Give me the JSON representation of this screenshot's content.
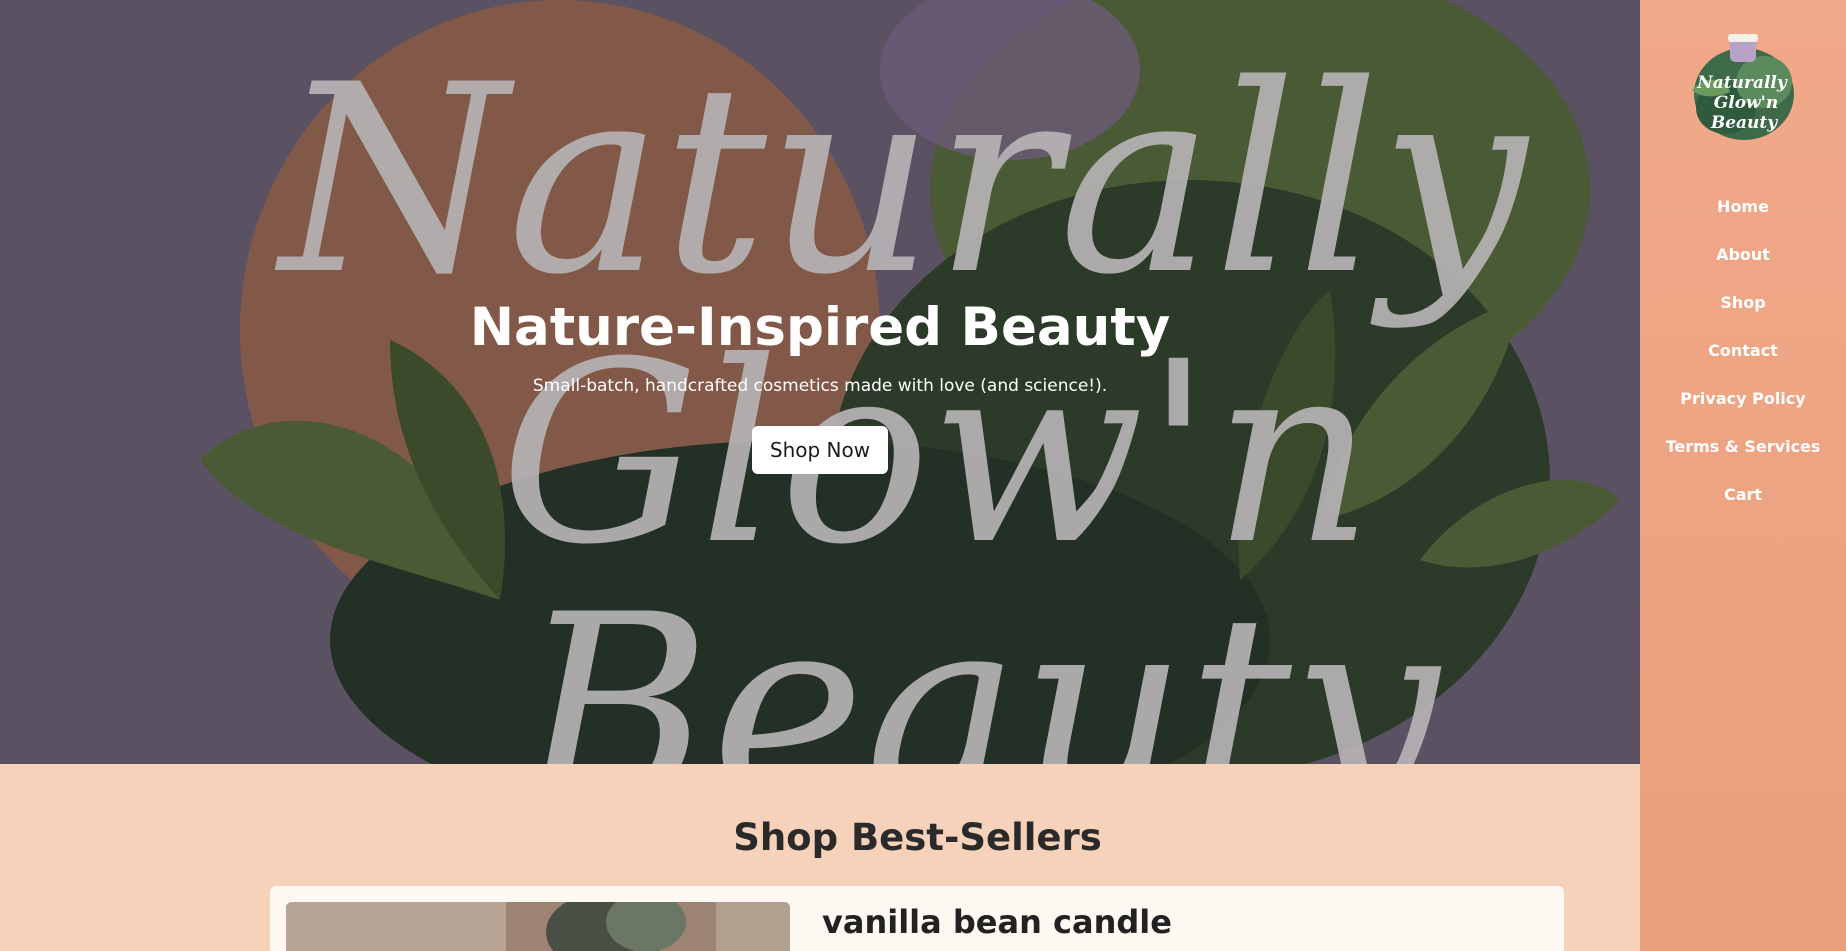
{
  "hero": {
    "title": "Nature-Inspired Beauty",
    "subtitle": "Small-batch, handcrafted cosmetics made with love (and science!).",
    "cta_label": "Shop Now",
    "background_text": [
      "Naturally",
      "Glow'n",
      "Beauty"
    ]
  },
  "section": {
    "title": "Shop Best-Sellers"
  },
  "product": {
    "title": "vanilla bean candle"
  },
  "sidebar": {
    "logo_text": [
      "Naturally",
      "Glow'n",
      "Beauty"
    ],
    "nav": [
      {
        "label": "Home"
      },
      {
        "label": "About"
      },
      {
        "label": "Shop"
      },
      {
        "label": "Contact"
      },
      {
        "label": "Privacy Policy"
      },
      {
        "label": "Terms & Services"
      },
      {
        "label": "Cart"
      }
    ]
  },
  "colors": {
    "sidebar": "#ea9f7b",
    "section_bg": "#f5d2b9",
    "hero_overlay": "#5a5262",
    "card_bg": "#fef8f2"
  }
}
